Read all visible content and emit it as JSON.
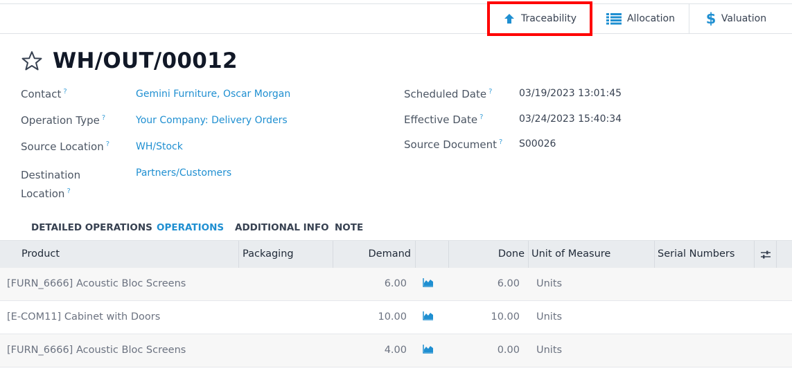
{
  "smart_buttons": {
    "traceability": "Traceability",
    "allocation": "Allocation",
    "valuation": "Valuation"
  },
  "record": {
    "title": "WH/OUT/00012"
  },
  "fields_left": {
    "contact_label": "Contact",
    "contact_value": "Gemini Furniture, Oscar Morgan",
    "operation_type_label": "Operation Type",
    "operation_type_value": "Your Company: Delivery Orders",
    "source_location_label": "Source Location",
    "source_location_value": "WH/Stock",
    "destination_location_label_1": "Destination",
    "destination_location_label_2": "Location",
    "destination_location_value": "Partners/Customers",
    "help_mark": "?"
  },
  "fields_right": {
    "scheduled_date_label": "Scheduled Date",
    "scheduled_date_value": "03/19/2023 13:01:45",
    "effective_date_label": "Effective Date",
    "effective_date_value": "03/24/2023 15:40:34",
    "source_document_label": "Source Document",
    "source_document_value": "S00026"
  },
  "tabs": [
    "DETAILED OPERATIONS",
    "OPERATIONS",
    "ADDITIONAL INFO",
    "NOTE"
  ],
  "active_tab": "OPERATIONS",
  "table": {
    "headers": {
      "product": "Product",
      "packaging": "Packaging",
      "demand": "Demand",
      "done": "Done",
      "uom": "Unit of Measure",
      "serials": "Serial Numbers"
    },
    "rows": [
      {
        "product": "[FURN_6666] Acoustic Bloc Screens",
        "demand": "6.00",
        "done": "6.00",
        "uom": "Units"
      },
      {
        "product": "[E-COM11] Cabinet with Doors",
        "demand": "10.00",
        "done": "10.00",
        "uom": "Units"
      },
      {
        "product": "[FURN_6666] Acoustic Bloc Screens",
        "demand": "4.00",
        "done": "0.00",
        "uom": "Units"
      }
    ]
  },
  "colors": {
    "link": "#1f8fd1",
    "highlight": "#ff0000",
    "header_bg": "#e9ecef"
  },
  "icons": {
    "traceability": "arrow-up-icon",
    "allocation": "list-icon",
    "valuation": "dollar-icon",
    "favorite": "star-outline-icon",
    "forecast": "area-chart-icon",
    "optional_columns": "sliders-icon"
  }
}
